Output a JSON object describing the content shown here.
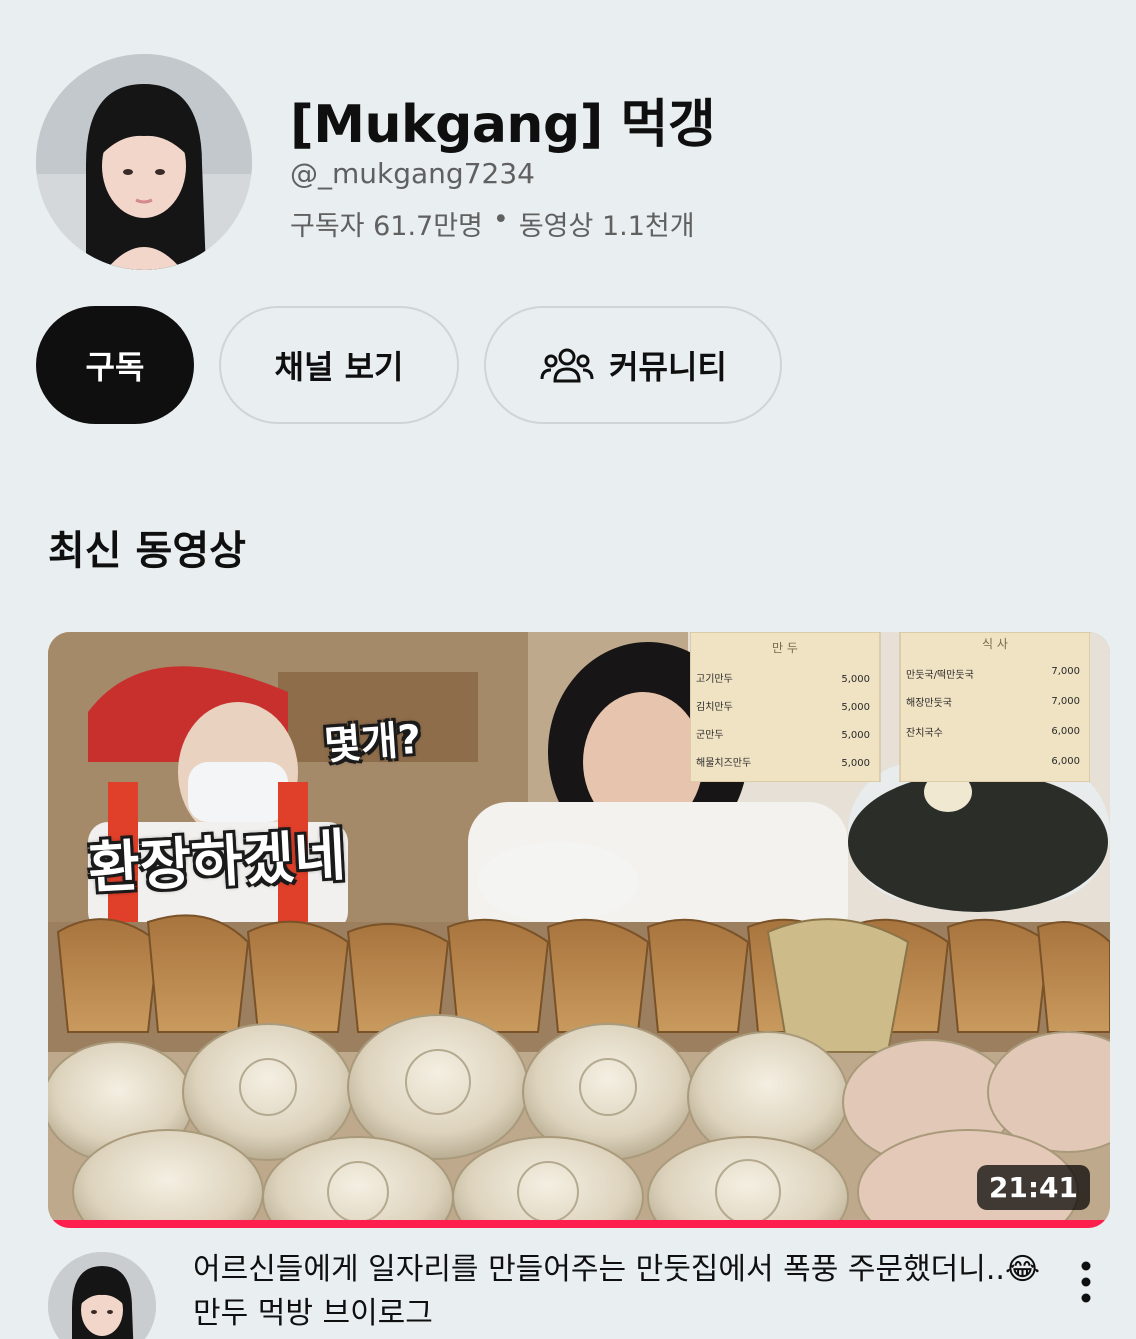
{
  "channel": {
    "title": "[Mukgang] 먹갱",
    "handle": "@_mukgang7234",
    "subscribers": "구독자 61.7만명",
    "separator": "•",
    "videos": "동영상 1.1천개",
    "avatar_icon": "channel-avatar"
  },
  "actions": {
    "subscribe_label": "구독",
    "view_channel_label": "채널 보기",
    "community_label": "커뮤니티",
    "community_icon": "people-icon"
  },
  "section": {
    "title": "최신 동영상"
  },
  "video": {
    "overlay_question": "몇개?",
    "overlay_caption": "환장하겠네",
    "duration": "21:41",
    "progress": 1.0,
    "title": "어르신들에게 일자리를 만들어주는 만둣집에서 폭풍 주문했더니..😂만두 먹방 브이로그",
    "menu_icon": "more-vert-icon"
  },
  "menu_board": {
    "left_header": "만 두",
    "right_header": "식 사",
    "left_items": [
      {
        "name": "고기만두",
        "price": "5,000"
      },
      {
        "name": "김치만두",
        "price": "5,000"
      },
      {
        "name": "군만두",
        "price": "5,000"
      },
      {
        "name": "해물치즈만두",
        "price": "5,000"
      }
    ],
    "right_items": [
      {
        "name": "만둣국/떡만둣국",
        "price": "7,000"
      },
      {
        "name": "해장만둣국",
        "price": "7,000"
      },
      {
        "name": "잔치국수",
        "price": "6,000"
      },
      {
        "name": "",
        "price": "6,000"
      }
    ]
  },
  "colors": {
    "background": "#e9eff1",
    "primary_button": "#0f0f0f",
    "progress": "#ff1f4f",
    "secondary_text": "#606060"
  }
}
